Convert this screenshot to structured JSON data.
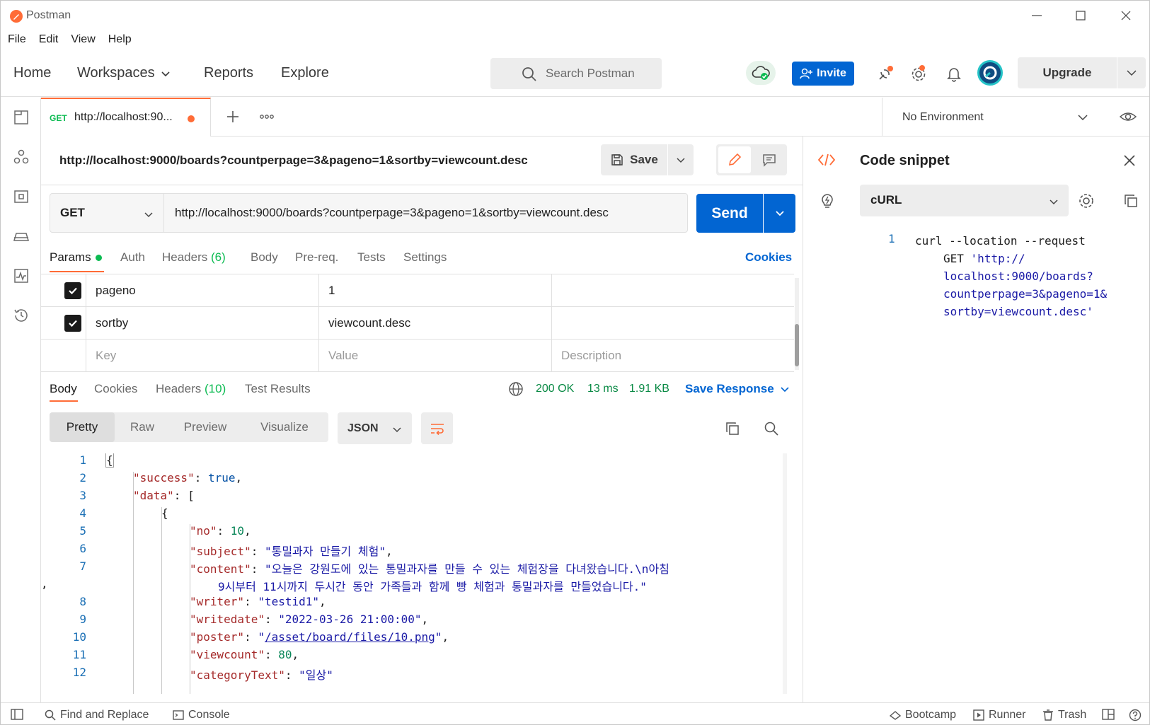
{
  "window": {
    "title": "Postman",
    "controls": [
      "minimize-icon",
      "maximize-icon",
      "close-icon"
    ]
  },
  "menu": [
    "File",
    "Edit",
    "View",
    "Help"
  ],
  "header": {
    "nav": [
      {
        "label": "Home"
      },
      {
        "label": "Workspaces",
        "has_dropdown": true
      },
      {
        "label": "Reports"
      },
      {
        "label": "Explore"
      }
    ],
    "search_placeholder": "Search Postman",
    "invite_label": "Invite",
    "upgrade_label": "Upgrade",
    "icons": [
      "cloud-sync-icon",
      "satellite-icon",
      "settings-icon",
      "bell-icon",
      "avatar"
    ]
  },
  "sidebar": {
    "icons": [
      "collections-icon",
      "apis-icon",
      "environments-icon",
      "mock-servers-icon",
      "monitors-icon",
      "history-icon"
    ]
  },
  "tabs": [
    {
      "method": "GET",
      "title": "http://localhost:90...",
      "unsaved": true
    }
  ],
  "environment": {
    "label": "No Environment"
  },
  "request": {
    "name": "http://localhost:9000/boards?countperpage=3&pageno=1&sortby=viewcount.desc",
    "save_label": "Save",
    "method": "GET",
    "url": "http://localhost:9000/boards?countperpage=3&pageno=1&sortby=viewcount.desc",
    "send_label": "Send",
    "tabs": [
      {
        "label": "Params",
        "active": true,
        "dot": true
      },
      {
        "label": "Auth"
      },
      {
        "label": "Headers",
        "count": "(6)"
      },
      {
        "label": "Body"
      },
      {
        "label": "Pre-req."
      },
      {
        "label": "Tests"
      },
      {
        "label": "Settings"
      }
    ],
    "cookies_label": "Cookies",
    "params": [
      {
        "checked": true,
        "key": "pageno",
        "value": "1",
        "description": ""
      },
      {
        "checked": true,
        "key": "sortby",
        "value": "viewcount.desc",
        "description": ""
      }
    ],
    "param_placeholders": {
      "key": "Key",
      "value": "Value",
      "description": "Description"
    }
  },
  "response": {
    "tabs": [
      {
        "label": "Body",
        "active": true
      },
      {
        "label": "Cookies"
      },
      {
        "label": "Headers",
        "count": "(10)"
      },
      {
        "label": "Test Results"
      }
    ],
    "status": "200 OK",
    "time": "13 ms",
    "size": "1.91 KB",
    "save_label": "Save Response",
    "views": [
      "Pretty",
      "Raw",
      "Preview",
      "Visualize"
    ],
    "active_view": "Pretty",
    "format": "JSON",
    "line_numbers": [
      "1",
      "2",
      "3",
      "4",
      "5",
      "6",
      "7",
      "",
      "8",
      "9",
      "10",
      "11",
      "12"
    ],
    "lines": {
      "l1": "{",
      "l2_key": "\"success\"",
      "l2_val": "true",
      "l3_key": "\"data\"",
      "l3_val": "[",
      "l4": "{",
      "l5_key": "\"no\"",
      "l5_val": "10",
      "l6_key": "\"subject\"",
      "l6_val": "\"통밀과자 만들기 체험\"",
      "l7_key": "\"content\"",
      "l7_val": "\"오늘은 강원도에 있는 통밀과자를 만들 수 있는 체험장을 다녀왔습니다.\\n아침",
      "l7_cont": "9시부터 11시까지 두시간 동안 가족들과 함께 빵 체험과 통밀과자를 만들었습니다.\"",
      "l8_key": "\"writer\"",
      "l8_val": "\"testid1\"",
      "l9_key": "\"writedate\"",
      "l9_val": "\"2022-03-26 21:00:00\"",
      "l10_key": "\"poster\"",
      "l10_val": "/asset/board/files/10.png",
      "l11_key": "\"viewcount\"",
      "l11_val": "80",
      "l12_key": "\"categoryText\"",
      "l12_val": "\"일상\""
    }
  },
  "code_snippet": {
    "title": "Code snippet",
    "language": "cURL",
    "line_number": "1",
    "cmd": "curl --location --request",
    "method": "GET",
    "url_lines": [
      "'http://",
      "localhost:9000/boards?",
      "countperpage=3&pageno=1&",
      "sortby=viewcount.desc'"
    ]
  },
  "statusbar": {
    "left": [
      "Find and Replace",
      "Console"
    ],
    "right": [
      "Bootcamp",
      "Runner",
      "Trash"
    ]
  }
}
